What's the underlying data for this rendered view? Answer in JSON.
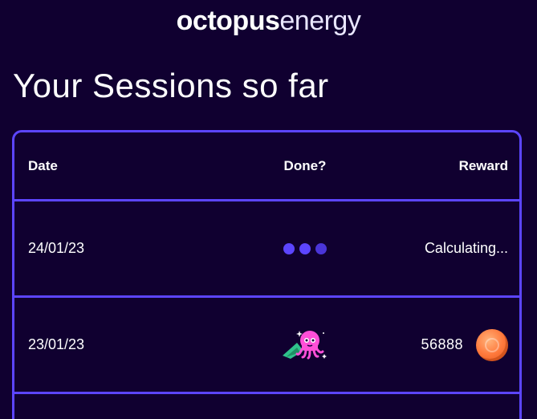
{
  "brand": {
    "name_bold": "octopus",
    "name_light": "energy"
  },
  "page": {
    "title": "Your Sessions so far"
  },
  "table": {
    "headers": {
      "date": "Date",
      "done": "Done?",
      "reward": "Reward"
    },
    "rows": [
      {
        "date": "24/01/23",
        "done_icon": "loading-dots-icon",
        "reward": "Calculating..."
      },
      {
        "date": "23/01/23",
        "done_icon": "octopus-mascot-icon",
        "reward": "56888",
        "reward_icon": "coin-icon"
      }
    ]
  },
  "colors": {
    "background": "#100030",
    "accent": "#5c45ff",
    "mascot_pink": "#ff4fd8",
    "coin_orange": "#ff7a3d"
  }
}
